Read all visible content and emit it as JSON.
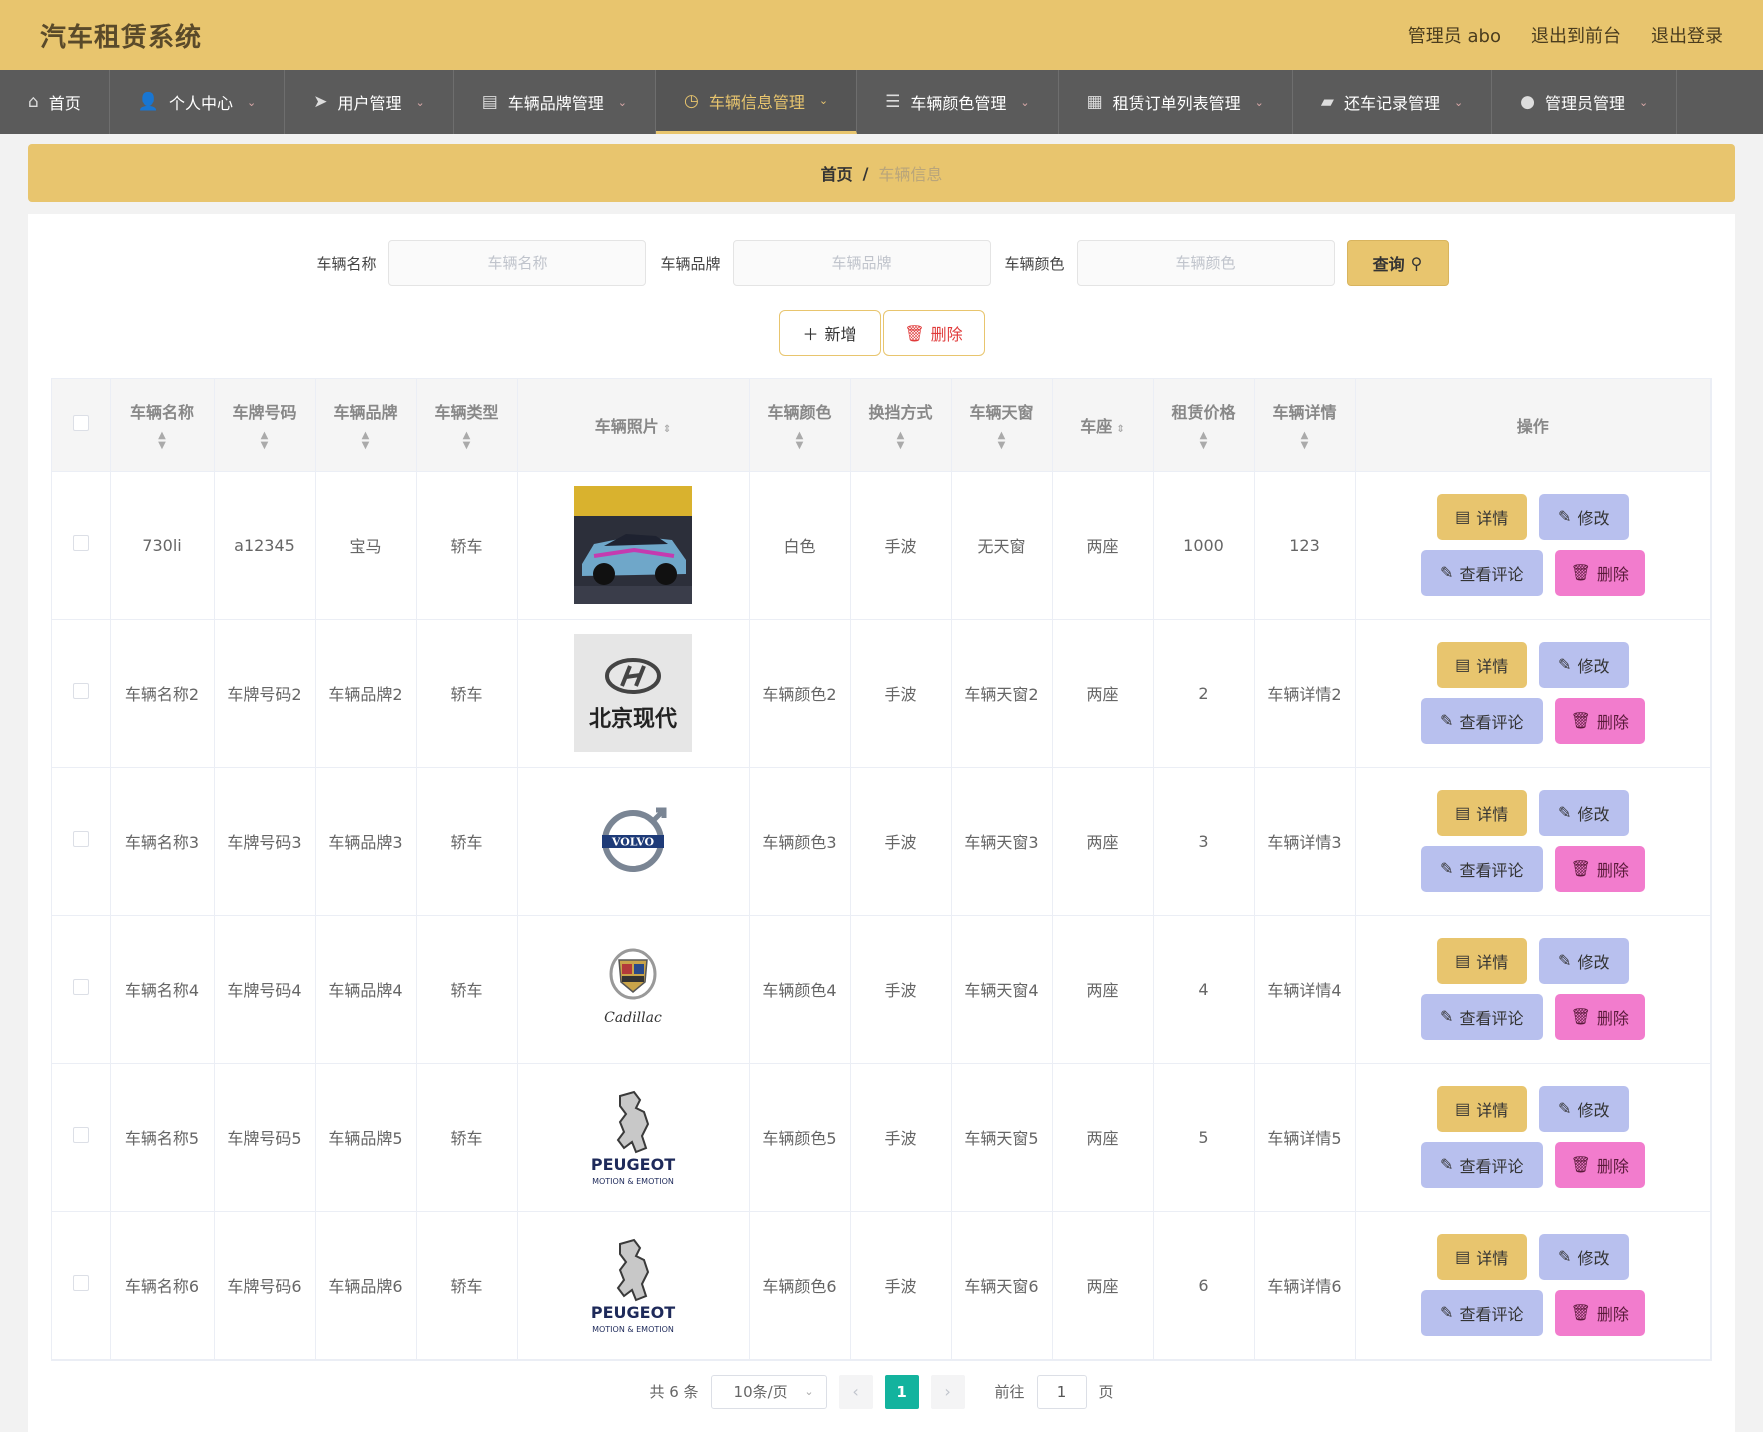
{
  "app": {
    "title": "汽车租赁系统",
    "top_links": [
      "管理员 abo",
      "退出到前台",
      "退出登录"
    ]
  },
  "nav": [
    {
      "label": "首页",
      "icon": "home-icon",
      "dropdown": false
    },
    {
      "label": "个人中心",
      "icon": "user-icon",
      "dropdown": true
    },
    {
      "label": "用户管理",
      "icon": "send-icon",
      "dropdown": true
    },
    {
      "label": "车辆品牌管理",
      "icon": "clipboard-icon",
      "dropdown": true
    },
    {
      "label": "车辆信息管理",
      "icon": "clock-icon",
      "dropdown": true,
      "active": true
    },
    {
      "label": "车辆颜色管理",
      "icon": "sliders-icon",
      "dropdown": true
    },
    {
      "label": "租赁订单列表管理",
      "icon": "document-icon",
      "dropdown": true
    },
    {
      "label": "还车记录管理",
      "icon": "wallet-icon",
      "dropdown": true
    },
    {
      "label": "管理员管理",
      "icon": "bulb-icon",
      "dropdown": true
    }
  ],
  "breadcrumb": {
    "home": "首页",
    "separator": "/",
    "current": "车辆信息"
  },
  "search": {
    "fields": [
      {
        "label": "车辆名称",
        "placeholder": "车辆名称"
      },
      {
        "label": "车辆品牌",
        "placeholder": "车辆品牌"
      },
      {
        "label": "车辆颜色",
        "placeholder": "车辆颜色"
      }
    ],
    "query_label": "查询"
  },
  "actions": {
    "add_label": "新增",
    "delete_label": "删除"
  },
  "table": {
    "columns": [
      "车辆名称",
      "车牌号码",
      "车辆品牌",
      "车辆类型",
      "车辆照片",
      "车辆颜色",
      "换挡方式",
      "车辆天窗",
      "车座",
      "租赁价格",
      "车辆详情",
      "操作"
    ],
    "rows": [
      {
        "name": "730li",
        "plate": "a12345",
        "brand": "宝马",
        "type": "轿车",
        "photo": "race-car-photo",
        "color": "白色",
        "gear": "手波",
        "sunroof": "无天窗",
        "seat": "两座",
        "price": "1000",
        "detail": "123"
      },
      {
        "name": "车辆名称2",
        "plate": "车牌号码2",
        "brand": "车辆品牌2",
        "type": "轿车",
        "photo": "hyundai-logo",
        "photo_text": "北京现代",
        "color": "车辆颜色2",
        "gear": "手波",
        "sunroof": "车辆天窗2",
        "seat": "两座",
        "price": "2",
        "detail": "车辆详情2"
      },
      {
        "name": "车辆名称3",
        "plate": "车牌号码3",
        "brand": "车辆品牌3",
        "type": "轿车",
        "photo": "volvo-logo",
        "photo_text": "VOLVO",
        "color": "车辆颜色3",
        "gear": "手波",
        "sunroof": "车辆天窗3",
        "seat": "两座",
        "price": "3",
        "detail": "车辆详情3"
      },
      {
        "name": "车辆名称4",
        "plate": "车牌号码4",
        "brand": "车辆品牌4",
        "type": "轿车",
        "photo": "cadillac-logo",
        "photo_text": "Cadillac",
        "color": "车辆颜色4",
        "gear": "手波",
        "sunroof": "车辆天窗4",
        "seat": "两座",
        "price": "4",
        "detail": "车辆详情4"
      },
      {
        "name": "车辆名称5",
        "plate": "车牌号码5",
        "brand": "车辆品牌5",
        "type": "轿车",
        "photo": "peugeot-logo",
        "photo_text": "PEUGEOT",
        "photo_subtext": "MOTION & EMOTION",
        "color": "车辆颜色5",
        "gear": "手波",
        "sunroof": "车辆天窗5",
        "seat": "两座",
        "price": "5",
        "detail": "车辆详情5"
      },
      {
        "name": "车辆名称6",
        "plate": "车牌号码6",
        "brand": "车辆品牌6",
        "type": "轿车",
        "photo": "peugeot-logo",
        "photo_text": "PEUGEOT",
        "photo_subtext": "MOTION & EMOTION",
        "color": "车辆颜色6",
        "gear": "手波",
        "sunroof": "车辆天窗6",
        "seat": "两座",
        "price": "6",
        "detail": "车辆详情6"
      }
    ],
    "row_actions": {
      "detail": "详情",
      "edit": "修改",
      "comment": "查看评论",
      "delete": "删除"
    }
  },
  "pagination": {
    "total_text": "共 6 条",
    "page_size": "10条/页",
    "current_page": "1",
    "goto_label": "前往",
    "goto_value": "1",
    "page_suffix": "页"
  },
  "colors": {
    "accent": "#e8c56e",
    "nav_bg": "#5b5b5b",
    "edit": "#b8c0ee",
    "delete": "#f27ccd",
    "page_active": "#13b39e"
  }
}
